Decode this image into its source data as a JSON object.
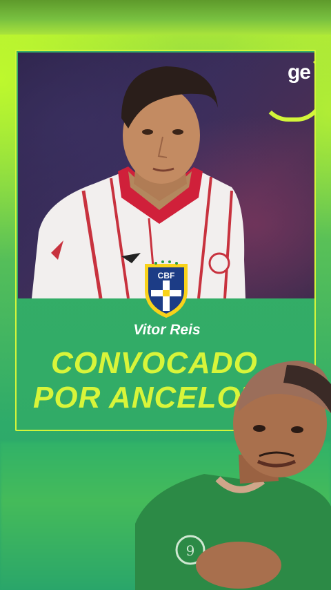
{
  "card": {
    "logo": "ge",
    "player_name": "Vitor Reis",
    "headline_line1": "CONVOCADO",
    "headline_line2": "POR ANCELOTTI",
    "badge_text": "CBF"
  },
  "colors": {
    "accent": "#d8f53a",
    "card_green": "#33ad67",
    "background_green": "#2eab6a"
  },
  "icons": [
    "cbf-crest-icon",
    "ge-logo-icon"
  ]
}
